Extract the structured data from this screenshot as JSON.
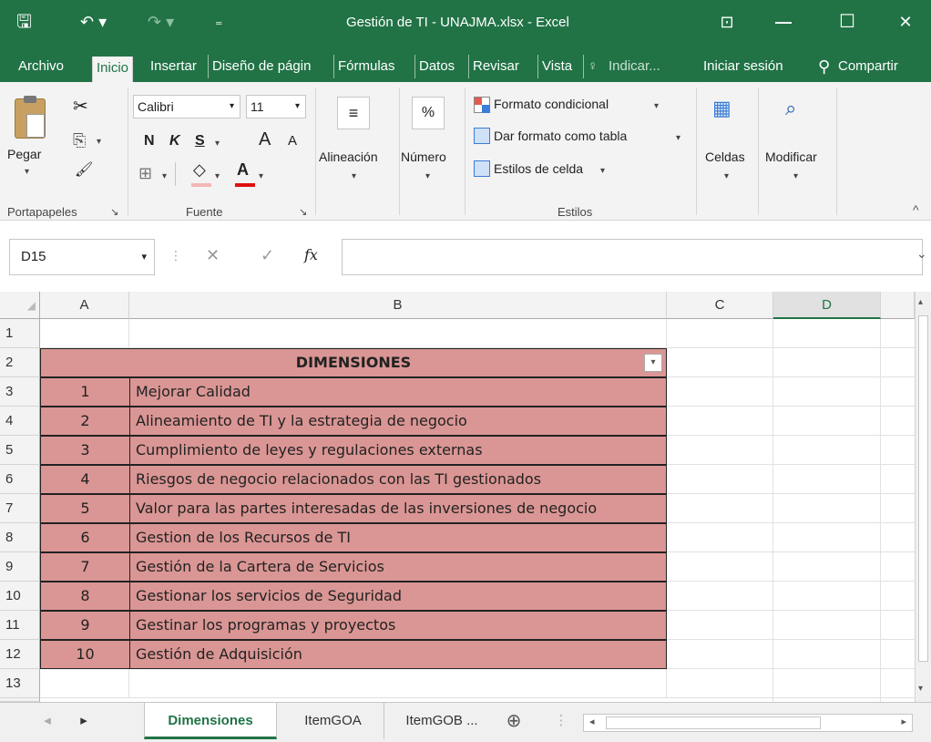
{
  "window": {
    "title": "Gestión de TI - UNAJMA.xlsx - Excel",
    "save_glyph": "🖫",
    "undo_glyph": "↶ ▾",
    "redo_glyph": "↷ ▾",
    "customize_glyph": "₌",
    "ribbon_display_glyph": "⊡",
    "minimize_glyph": "—",
    "maximize_glyph": "☐",
    "close_glyph": "✕"
  },
  "menu": {
    "tabs": [
      "Archivo",
      "Inicio",
      "Insertar",
      "Diseño de págin",
      "Fórmulas",
      "Datos",
      "Revisar",
      "Vista"
    ],
    "tell_me": "Indicar...",
    "tell_me_glyph": "♀",
    "sign_in": "Iniciar sesión",
    "share": "Compartir",
    "share_glyph": "⚲"
  },
  "ribbon": {
    "clipboard": {
      "paste": "Pegar",
      "paste_caret": "▾",
      "cut_glyph": "✂",
      "copy_glyph": "⎘",
      "format_painter_glyph": "🖌",
      "label": "Portapapeles",
      "launcher": "↘"
    },
    "font": {
      "name": "Calibri",
      "size": "11",
      "caret": "▾",
      "bold": "N",
      "italic": "K",
      "underline": "S",
      "grow": "A",
      "shrink": "A",
      "border_glyph": "⊞",
      "fill_glyph": "◇",
      "color_glyph": "A",
      "label": "Fuente",
      "launcher": "↘"
    },
    "alignment": {
      "label": "Alineación",
      "glyph": "≡",
      "caret": "▾"
    },
    "number": {
      "label": "Número",
      "glyph": "%",
      "caret": "▾"
    },
    "styles": {
      "conditional": "Formato condicional",
      "as_table": "Dar formato como tabla",
      "cell_styles": "Estilos de celda",
      "caret": "▾",
      "label": "Estilos"
    },
    "cells": {
      "label": "Celdas",
      "glyph": "▦",
      "caret": "▾"
    },
    "editing": {
      "label": "Modificar",
      "glyph": "⌕",
      "caret": "▾"
    },
    "collapse_glyph": "^"
  },
  "formula_bar": {
    "name_box": "D15",
    "name_caret": "▾",
    "sep_glyph": "⋮",
    "cancel_glyph": "✕",
    "enter_glyph": "✓",
    "fx": "fx",
    "value": "",
    "expand_glyph": "⌄"
  },
  "sheet": {
    "corner_glyph": "◢",
    "columns": [
      "A",
      "B",
      "C",
      "D"
    ],
    "rows": [
      "1",
      "2",
      "3",
      "4",
      "5",
      "6",
      "7",
      "8",
      "9",
      "10",
      "11",
      "12",
      "13"
    ],
    "header": "DIMENSIONES",
    "filter_glyph": "▾",
    "items": [
      {
        "num": "1",
        "text": "Mejorar Calidad"
      },
      {
        "num": "2",
        "text": "Alineamiento de TI y la estrategia de negocio"
      },
      {
        "num": "3",
        "text": "Cumplimiento de leyes y regulaciones externas"
      },
      {
        "num": "4",
        "text": "Riesgos de negocio relacionados con las TI gestionados"
      },
      {
        "num": "5",
        "text": "Valor para las partes interesadas de las inversiones de negocio"
      },
      {
        "num": "6",
        "text": "Gestion de los Recursos de TI"
      },
      {
        "num": "7",
        "text": "Gestión de la Cartera de Servicios"
      },
      {
        "num": "8",
        "text": "Gestionar los servicios de Seguridad"
      },
      {
        "num": "9",
        "text": "Gestinar los programas y proyectos"
      },
      {
        "num": "10",
        "text": "Gestión de Adquisición"
      }
    ],
    "scroll_up_glyph": "▴",
    "scroll_down_glyph": "▾",
    "fill_color": "#da9694"
  },
  "tabs_bar": {
    "prev_glyph": "◂",
    "next_glyph": "▸",
    "sheets": [
      "Dimensiones",
      "ItemGOA",
      "ItemGOB ..."
    ],
    "add_glyph": "⊕",
    "more_glyph": "⋮",
    "scroll_left_glyph": "◂",
    "scroll_right_glyph": "▸"
  },
  "colors": {
    "accent": "#217346"
  }
}
